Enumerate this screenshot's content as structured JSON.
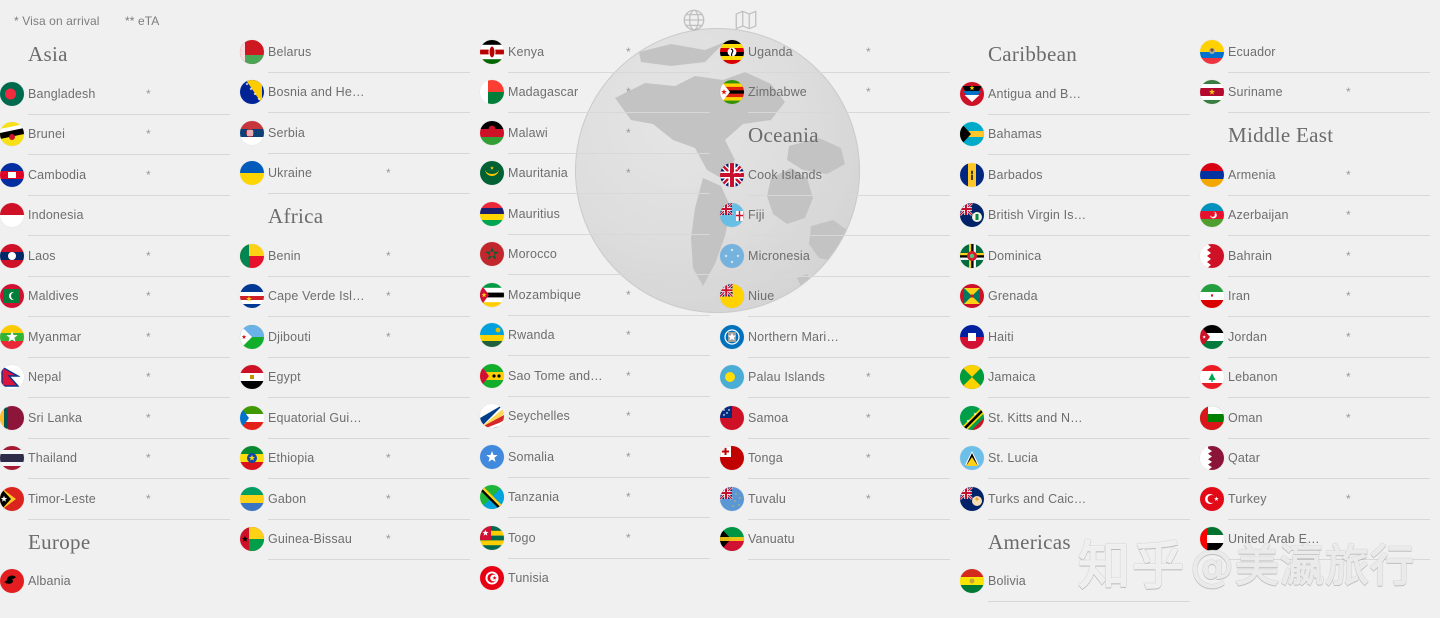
{
  "legend": {
    "visa_on_arrival": "* Visa on arrival",
    "eta": "** eTA"
  },
  "top_icons": [
    {
      "name": "globe-icon",
      "label": "globe"
    },
    {
      "name": "map-icon",
      "label": "map"
    }
  ],
  "watermarks": {
    "zhihu": "知乎",
    "brand": "@美瀛旅行"
  },
  "colors": {
    "background": "#f0f0f0",
    "divider": "#d8d8d8",
    "text": "#6e6e6e",
    "region_heading": "#6b6b6b",
    "star": "#9a9a9a"
  },
  "columns": [
    {
      "id": "col-1",
      "blocks": [
        {
          "region": "Asia",
          "countries": [
            {
              "name": "Bangladesh",
              "mark": "*",
              "flag": "bangladesh"
            },
            {
              "name": "Brunei",
              "mark": "*",
              "flag": "brunei"
            },
            {
              "name": "Cambodia",
              "mark": "*",
              "flag": "cambodia"
            },
            {
              "name": "Indonesia",
              "mark": "",
              "flag": "indonesia"
            },
            {
              "name": "Laos",
              "mark": "*",
              "flag": "laos"
            },
            {
              "name": "Maldives",
              "mark": "*",
              "flag": "maldives"
            },
            {
              "name": "Myanmar",
              "mark": "*",
              "flag": "myanmar"
            },
            {
              "name": "Nepal",
              "mark": "*",
              "flag": "nepal"
            },
            {
              "name": "Sri Lanka",
              "mark": "*",
              "flag": "srilanka"
            },
            {
              "name": "Thailand",
              "mark": "*",
              "flag": "thailand"
            },
            {
              "name": "Timor-Leste",
              "mark": "*",
              "flag": "timorleste"
            }
          ]
        },
        {
          "region": "Europe",
          "countries": [
            {
              "name": "Albania",
              "mark": "",
              "flag": "albania",
              "last": true
            }
          ]
        }
      ]
    },
    {
      "id": "col-2",
      "blocks": [
        {
          "region": "",
          "countries": [
            {
              "name": "Belarus",
              "mark": "",
              "flag": "belarus"
            },
            {
              "name": "Bosnia and He…",
              "mark": "",
              "flag": "bosnia"
            },
            {
              "name": "Serbia",
              "mark": "",
              "flag": "serbia"
            },
            {
              "name": "Ukraine",
              "mark": "*",
              "flag": "ukraine"
            }
          ]
        },
        {
          "region": "Africa",
          "countries": [
            {
              "name": "Benin",
              "mark": "*",
              "flag": "benin"
            },
            {
              "name": "Cape Verde Isl…",
              "mark": "*",
              "flag": "capeverde"
            },
            {
              "name": "Djibouti",
              "mark": "*",
              "flag": "djibouti"
            },
            {
              "name": "Egypt",
              "mark": "",
              "flag": "egypt"
            },
            {
              "name": "Equatorial Gui…",
              "mark": "",
              "flag": "eqguinea"
            },
            {
              "name": "Ethiopia",
              "mark": "*",
              "flag": "ethiopia"
            },
            {
              "name": "Gabon",
              "mark": "*",
              "flag": "gabon"
            },
            {
              "name": "Guinea-Bissau",
              "mark": "*",
              "flag": "guineabissau"
            }
          ]
        }
      ]
    },
    {
      "id": "col-3",
      "blocks": [
        {
          "region": "",
          "countries": [
            {
              "name": "Kenya",
              "mark": "*",
              "flag": "kenya"
            },
            {
              "name": "Madagascar",
              "mark": "*",
              "flag": "madagascar"
            },
            {
              "name": "Malawi",
              "mark": "*",
              "flag": "malawi"
            },
            {
              "name": "Mauritania",
              "mark": "*",
              "flag": "mauritania"
            },
            {
              "name": "Mauritius",
              "mark": "",
              "flag": "mauritius"
            },
            {
              "name": "Morocco",
              "mark": "",
              "flag": "morocco"
            },
            {
              "name": "Mozambique",
              "mark": "*",
              "flag": "mozambique"
            },
            {
              "name": "Rwanda",
              "mark": "*",
              "flag": "rwanda"
            },
            {
              "name": "Sao Tome and…",
              "mark": "*",
              "flag": "saotome"
            },
            {
              "name": "Seychelles",
              "mark": "*",
              "flag": "seychelles"
            },
            {
              "name": "Somalia",
              "mark": "*",
              "flag": "somalia"
            },
            {
              "name": "Tanzania",
              "mark": "*",
              "flag": "tanzania"
            },
            {
              "name": "Togo",
              "mark": "*",
              "flag": "togo"
            },
            {
              "name": "Tunisia",
              "mark": "",
              "flag": "tunisia",
              "last": true
            }
          ]
        }
      ]
    },
    {
      "id": "col-4",
      "blocks": [
        {
          "region": "",
          "countries": [
            {
              "name": "Uganda",
              "mark": "*",
              "flag": "uganda"
            },
            {
              "name": "Zimbabwe",
              "mark": "*",
              "flag": "zimbabwe"
            }
          ]
        },
        {
          "region": "Oceania",
          "countries": [
            {
              "name": "Cook Islands",
              "mark": "",
              "flag": "cookislands"
            },
            {
              "name": "Fiji",
              "mark": "",
              "flag": "fiji"
            },
            {
              "name": "Micronesia",
              "mark": "",
              "flag": "micronesia"
            },
            {
              "name": "Niue",
              "mark": "",
              "flag": "niue"
            },
            {
              "name": "Northern Mari…",
              "mark": "",
              "flag": "nmariana"
            },
            {
              "name": "Palau Islands",
              "mark": "*",
              "flag": "palau"
            },
            {
              "name": "Samoa",
              "mark": "*",
              "flag": "samoa"
            },
            {
              "name": "Tonga",
              "mark": "*",
              "flag": "tonga"
            },
            {
              "name": "Tuvalu",
              "mark": "*",
              "flag": "tuvalu"
            },
            {
              "name": "Vanuatu",
              "mark": "",
              "flag": "vanuatu"
            }
          ]
        }
      ]
    },
    {
      "id": "col-5",
      "blocks": [
        {
          "region": "Caribbean",
          "countries": [
            {
              "name": "Antigua and B…",
              "mark": "",
              "flag": "antigua"
            },
            {
              "name": "Bahamas",
              "mark": "",
              "flag": "bahamas"
            },
            {
              "name": "Barbados",
              "mark": "",
              "flag": "barbados"
            },
            {
              "name": "British Virgin Is…",
              "mark": "",
              "flag": "bvi"
            },
            {
              "name": "Dominica",
              "mark": "",
              "flag": "dominica"
            },
            {
              "name": "Grenada",
              "mark": "",
              "flag": "grenada"
            },
            {
              "name": "Haiti",
              "mark": "",
              "flag": "haiti"
            },
            {
              "name": "Jamaica",
              "mark": "",
              "flag": "jamaica"
            },
            {
              "name": "St. Kitts and N…",
              "mark": "",
              "flag": "stkitts"
            },
            {
              "name": "St. Lucia",
              "mark": "",
              "flag": "stlucia"
            },
            {
              "name": "Turks and Caic…",
              "mark": "",
              "flag": "turks"
            }
          ]
        },
        {
          "region": "Americas",
          "countries": [
            {
              "name": "Bolivia",
              "mark": "*",
              "flag": "bolivia"
            }
          ]
        }
      ]
    },
    {
      "id": "col-6",
      "blocks": [
        {
          "region": "",
          "countries": [
            {
              "name": "Ecuador",
              "mark": "",
              "flag": "ecuador"
            },
            {
              "name": "Suriname",
              "mark": "*",
              "flag": "suriname"
            }
          ]
        },
        {
          "region": "Middle East",
          "countries": [
            {
              "name": "Armenia",
              "mark": "*",
              "flag": "armenia"
            },
            {
              "name": "Azerbaijan",
              "mark": "*",
              "flag": "azerbaijan"
            },
            {
              "name": "Bahrain",
              "mark": "*",
              "flag": "bahrain"
            },
            {
              "name": "Iran",
              "mark": "*",
              "flag": "iran"
            },
            {
              "name": "Jordan",
              "mark": "*",
              "flag": "jordan"
            },
            {
              "name": "Lebanon",
              "mark": "*",
              "flag": "lebanon"
            },
            {
              "name": "Oman",
              "mark": "*",
              "flag": "oman"
            },
            {
              "name": "Qatar",
              "mark": "",
              "flag": "qatar"
            },
            {
              "name": "Turkey",
              "mark": "*",
              "flag": "turkey"
            },
            {
              "name": "United Arab E…",
              "mark": "",
              "flag": "uae"
            }
          ]
        }
      ]
    }
  ]
}
